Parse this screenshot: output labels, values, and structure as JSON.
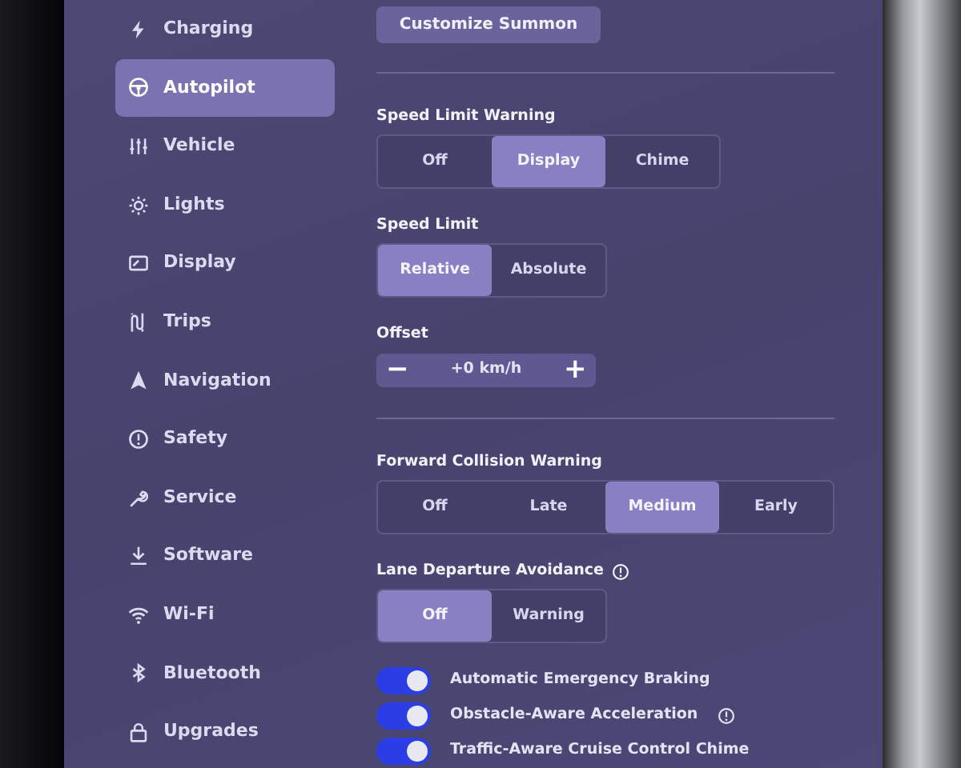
{
  "sidebar": {
    "items": [
      {
        "label": "Charging",
        "selected": false
      },
      {
        "label": "Autopilot",
        "selected": true
      },
      {
        "label": "Vehicle",
        "selected": false
      },
      {
        "label": "Lights",
        "selected": false
      },
      {
        "label": "Display",
        "selected": false
      },
      {
        "label": "Trips",
        "selected": false
      },
      {
        "label": "Navigation",
        "selected": false
      },
      {
        "label": "Safety",
        "selected": false
      },
      {
        "label": "Service",
        "selected": false
      },
      {
        "label": "Software",
        "selected": false
      },
      {
        "label": "Wi-Fi",
        "selected": false
      },
      {
        "label": "Bluetooth",
        "selected": false
      },
      {
        "label": "Upgrades",
        "selected": false
      }
    ]
  },
  "content": {
    "sections": [
      {
        "kind": "button",
        "label": "Customize Summon"
      },
      {
        "kind": "divider"
      },
      {
        "kind": "segmented",
        "label": "Speed Limit Warning",
        "info": false,
        "options": [
          {
            "label": "Off",
            "selected": false
          },
          {
            "label": "Display",
            "selected": true
          },
          {
            "label": "Chime",
            "selected": false
          }
        ]
      },
      {
        "kind": "segmented",
        "label": "Speed Limit",
        "info": false,
        "options": [
          {
            "label": "Relative",
            "selected": true
          },
          {
            "label": "Absolute",
            "selected": false
          }
        ]
      },
      {
        "kind": "stepper",
        "label": "Offset",
        "value": "+0 km/h",
        "minus": "−",
        "plus": "+"
      },
      {
        "kind": "divider"
      },
      {
        "kind": "segmented",
        "label": "Forward Collision Warning",
        "info": false,
        "options": [
          {
            "label": "Off",
            "selected": false
          },
          {
            "label": "Late",
            "selected": false
          },
          {
            "label": "Medium",
            "selected": true
          },
          {
            "label": "Early",
            "selected": false
          }
        ]
      },
      {
        "kind": "segmented",
        "label": "Lane Departure Avoidance",
        "info": true,
        "options": [
          {
            "label": "Off",
            "selected": true
          },
          {
            "label": "Warning",
            "selected": false
          }
        ]
      },
      {
        "kind": "toggle",
        "label": "Automatic Emergency Braking",
        "on": true,
        "info": false
      },
      {
        "kind": "toggle",
        "label": "Obstacle-Aware Acceleration",
        "on": true,
        "info": true
      },
      {
        "kind": "toggle",
        "label": "Traffic-Aware Cruise Control Chime",
        "on": true,
        "info": false
      }
    ]
  }
}
